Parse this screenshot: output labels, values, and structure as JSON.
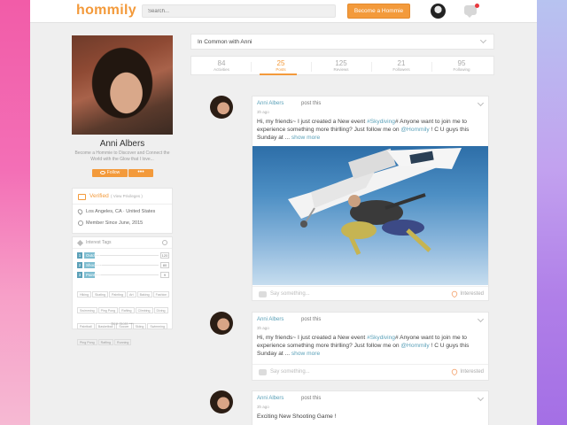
{
  "header": {
    "logo": "hommily",
    "search_placeholder": "Search...",
    "become_button": "Become a Hommie"
  },
  "profile": {
    "name": "Anni Albers",
    "bio": "Become a Hommie to Discover and Connect the World with the Glow that I love...",
    "follow_label": "Follow",
    "more_label": "•••"
  },
  "verified": {
    "title": "Verified",
    "note": "( View Privileges )",
    "location": "Los Angeles, CA · United States",
    "member_since": "Member Since June, 2015"
  },
  "interests": {
    "title": "Interest Tags",
    "top": [
      {
        "rank": "1",
        "tag": "Outdoor",
        "count": "120",
        "share": 0.14
      },
      {
        "rank": "2",
        "tag": "Shooting",
        "count": "80",
        "share": 0.14
      },
      {
        "rank": "3",
        "tag": "Paintball",
        "count": "9",
        "share": 0.14
      }
    ],
    "chips": [
      "Hiking",
      "Skating",
      "Painting",
      "Art",
      "Baking",
      "Fashion",
      "Swimming",
      "Ping Pong",
      "Rafting",
      "Climbing",
      "Diving",
      "Paintball",
      "Basketball",
      "Soccer",
      "Skiing",
      "Swimming",
      "Ping Pong",
      "Rafting",
      "Running"
    ],
    "see_more": "See more •••"
  },
  "common": {
    "label": "In Common with Anni"
  },
  "stats": [
    {
      "num": "84",
      "label": "Activities"
    },
    {
      "num": "25",
      "label": "Posts",
      "active": true
    },
    {
      "num": "125",
      "label": "Reviews"
    },
    {
      "num": "21",
      "label": "Followers"
    },
    {
      "num": "95",
      "label": "Following"
    }
  ],
  "posts": [
    {
      "author": "Anni Albers",
      "action": "post this",
      "time": "3h ago",
      "text_a": "Hi, my friends~ I just created a  New event ",
      "tag": "#Skydiving",
      "text_b": "# Anyone want to join me to experience something more thirlling? Just follow me on ",
      "mention": "@Hommily",
      "text_c": " ! C U guys this Sunday at ... ",
      "more": "show more",
      "comment_placeholder": "Say something...",
      "interested": "Interested"
    },
    {
      "author": "Anni Albers",
      "action": "post this",
      "time": "3h ago",
      "text_a": "Hi, my friends~ I just created a  New event ",
      "tag": "#Skydiving",
      "text_b": "# Anyone want to join me to experience something more thirlling? Just follow me on ",
      "mention": "@Hommily",
      "text_c": " ! C U guys this Sunday at ... ",
      "more": "show more",
      "comment_placeholder": "Say something...",
      "interested": "Interested"
    },
    {
      "author": "Anni Albers",
      "action": "post this",
      "time": "3h ago",
      "text_a": "Exciting New Shooting Game !"
    }
  ]
}
